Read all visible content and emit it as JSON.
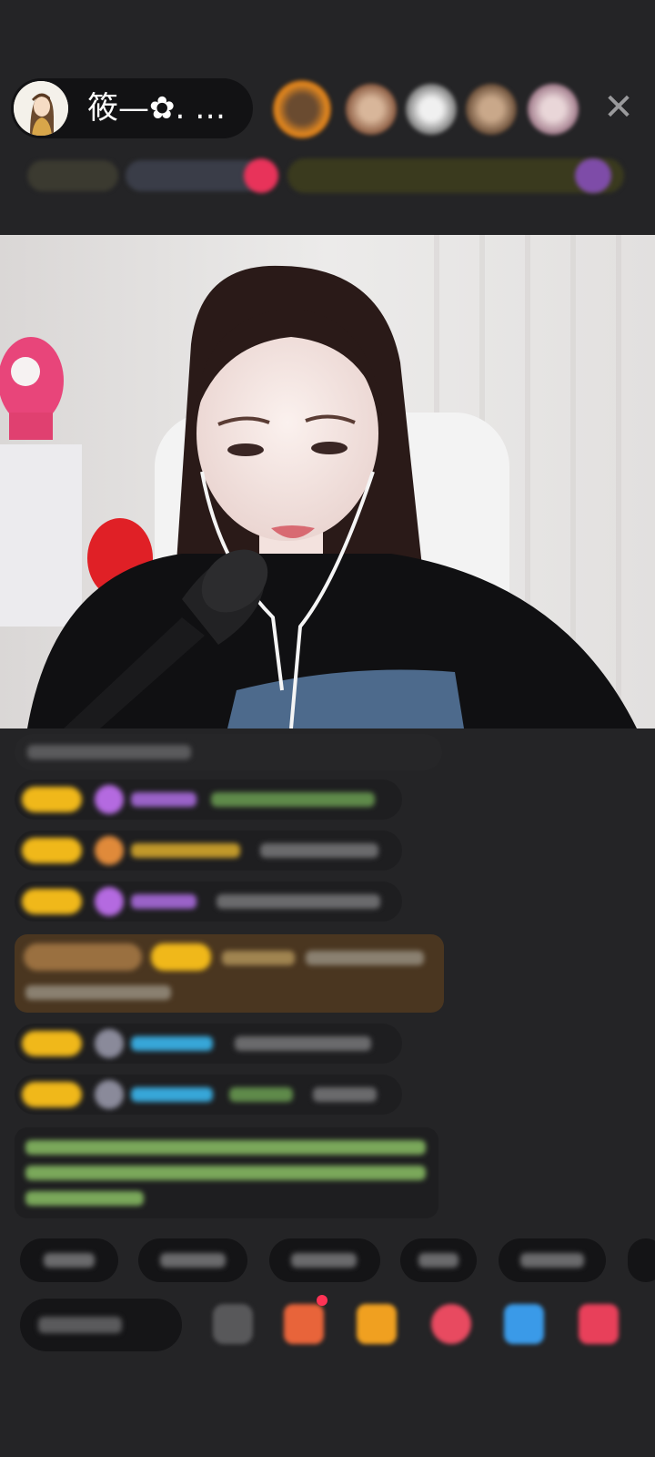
{
  "header": {
    "host_name": "筱—✿. …",
    "close_icon": "close-icon"
  },
  "colors": {
    "background": "#242426",
    "pill": "#121214",
    "badge_yellow": "#f0b81a",
    "chat_green": "#8fd46a",
    "chat_cyan": "#37a6d8",
    "chat_purple": "#b46ae0"
  }
}
